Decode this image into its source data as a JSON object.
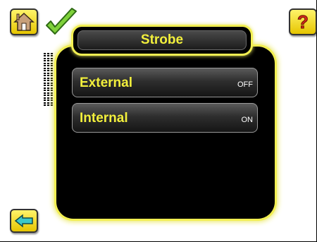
{
  "title": "Strobe",
  "settings": [
    {
      "label": "External",
      "value": "OFF"
    },
    {
      "label": "Internal",
      "value": "ON"
    }
  ],
  "icons": {
    "home": "home-icon",
    "confirm": "checkmark-icon",
    "help": "question-mark-icon",
    "back": "back-arrow-icon"
  },
  "colors": {
    "accent": "#f2ef3c",
    "button": "#e6c500",
    "background": "#000000"
  }
}
